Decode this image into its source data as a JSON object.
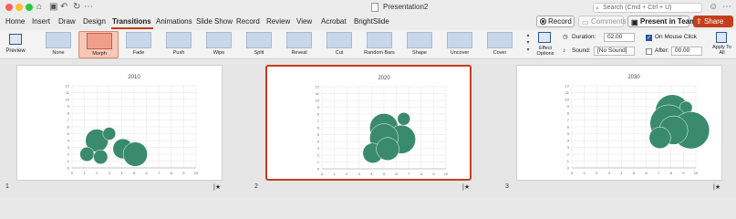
{
  "titlebar": {
    "document_title": "Presentation2",
    "search_placeholder": "Search (Cmd + Ctrl + U)"
  },
  "tabs": [
    "Home",
    "Insert",
    "Draw",
    "Design",
    "Transitions",
    "Animations",
    "Slide Show",
    "Record",
    "Review",
    "View",
    "Acrobat",
    "BrightSlide"
  ],
  "active_tab": "Transitions",
  "header_buttons": {
    "record": "Record",
    "comments": "Comments",
    "present_teams": "Present in Teams",
    "share": "Share"
  },
  "ribbon": {
    "preview_label": "Preview",
    "transitions": [
      "None",
      "Morph",
      "Fade",
      "Push",
      "Wipe",
      "Split",
      "Reveal",
      "Cut",
      "Random Bars",
      "Shape",
      "Uncover",
      "Cover"
    ],
    "selected_transition": "Morph",
    "effect_options_label": "Effect Options",
    "duration_label": "Duration:",
    "duration_value": "02.00",
    "sound_label": "Sound:",
    "sound_value": "[No Sound]",
    "on_mouse_click_label": "On Mouse Click",
    "on_mouse_click_checked": true,
    "after_label": "After:",
    "after_value": "00.00",
    "after_checked": false,
    "apply_to_all_label": "Apply To All"
  },
  "slides": [
    {
      "number": "1",
      "selected": false,
      "chart_title": "2010",
      "bubbles": [
        {
          "x": 2,
          "y": 4,
          "size": 1.6
        },
        {
          "x": 3,
          "y": 5,
          "size": 0.9
        },
        {
          "x": 1.2,
          "y": 2,
          "size": 1.0
        },
        {
          "x": 2.3,
          "y": 1.6,
          "size": 1.0
        },
        {
          "x": 4.1,
          "y": 2.8,
          "size": 1.4
        },
        {
          "x": 5.1,
          "y": 2,
          "size": 1.7
        }
      ]
    },
    {
      "number": "2",
      "selected": true,
      "chart_title": "2020",
      "bubbles": [
        {
          "x": 5,
          "y": 6,
          "size": 2.0
        },
        {
          "x": 6.6,
          "y": 7.3,
          "size": 0.9
        },
        {
          "x": 6.4,
          "y": 4.3,
          "size": 2.0
        },
        {
          "x": 5,
          "y": 4.5,
          "size": 2.0
        },
        {
          "x": 4.1,
          "y": 2.3,
          "size": 1.4
        },
        {
          "x": 5.3,
          "y": 2.9,
          "size": 1.6
        }
      ]
    },
    {
      "number": "3",
      "selected": false,
      "chart_title": "2030",
      "bubbles": [
        {
          "x": 8.1,
          "y": 8.2,
          "size": 2.4
        },
        {
          "x": 9.2,
          "y": 8.8,
          "size": 0.9
        },
        {
          "x": 7.8,
          "y": 6.5,
          "size": 2.6
        },
        {
          "x": 9.6,
          "y": 5.5,
          "size": 2.6
        },
        {
          "x": 8.2,
          "y": 5.5,
          "size": 2.0
        },
        {
          "x": 7.1,
          "y": 4.4,
          "size": 1.5
        }
      ]
    }
  ],
  "chart_axes": {
    "x_ticks": [
      "0",
      "1",
      "2",
      "3",
      "4",
      "5",
      "6",
      "7",
      "8",
      "9",
      "10"
    ],
    "y_ticks": [
      "0",
      "1",
      "2",
      "3",
      "4",
      "5",
      "6",
      "7",
      "8",
      "9",
      "10",
      "11",
      "12"
    ],
    "xlim": [
      0,
      10
    ],
    "ylim": [
      0,
      12
    ],
    "grid": true
  },
  "colors": {
    "bubble": "#3a8a6e",
    "accent": "#c43e1c"
  },
  "chart_data": [
    {
      "type": "scatter",
      "title": "2010",
      "series": [
        {
          "x": [
            2,
            3,
            1.2,
            2.3,
            4.1,
            5.1
          ],
          "y": [
            4,
            5,
            2,
            1.6,
            2.8,
            2
          ],
          "size": [
            1.6,
            0.9,
            1.0,
            1.0,
            1.4,
            1.7
          ]
        }
      ],
      "xlim": [
        0,
        10
      ],
      "ylim": [
        0,
        12
      ]
    },
    {
      "type": "scatter",
      "title": "2020",
      "series": [
        {
          "x": [
            5,
            6.6,
            6.4,
            5,
            4.1,
            5.3
          ],
          "y": [
            6,
            7.3,
            4.3,
            4.5,
            2.3,
            2.9
          ],
          "size": [
            2.0,
            0.9,
            2.0,
            2.0,
            1.4,
            1.6
          ]
        }
      ],
      "xlim": [
        0,
        10
      ],
      "ylim": [
        0,
        12
      ]
    },
    {
      "type": "scatter",
      "title": "2030",
      "series": [
        {
          "x": [
            8.1,
            9.2,
            7.8,
            9.6,
            8.2,
            7.1
          ],
          "y": [
            8.2,
            8.8,
            6.5,
            5.5,
            5.5,
            4.4
          ],
          "size": [
            2.4,
            0.9,
            2.6,
            2.6,
            2.0,
            1.5
          ]
        }
      ],
      "xlim": [
        0,
        10
      ],
      "ylim": [
        0,
        12
      ]
    }
  ]
}
